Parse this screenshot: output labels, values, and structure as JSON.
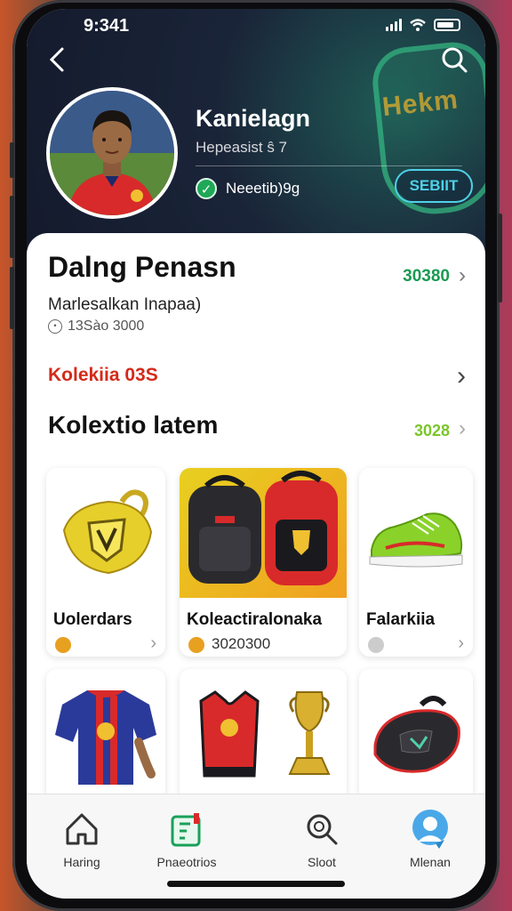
{
  "status_bar": {
    "time": "9:341"
  },
  "profile": {
    "name": "Kanielagn",
    "subtitle": "Hepeasist ŝ 7",
    "verified_label": "Neeetib)9g",
    "action_button": "SEBIIT",
    "banner_text": "Hekm"
  },
  "main": {
    "title": "Dalng Penasn",
    "title_count": "30380",
    "subtitle": "Marlesalkan Inapaa)",
    "meta": "13Sào 3000",
    "red_section": "Kolekiia 03S",
    "collection_title": "Kolextio latem",
    "collection_count": "3028"
  },
  "products": [
    {
      "name": "Uolerdars",
      "price": ""
    },
    {
      "name": "Koleactiralonaka",
      "price": "3020300"
    },
    {
      "name": "Falarkiia",
      "price": ""
    }
  ],
  "nav": {
    "items": [
      {
        "label": "Haring",
        "icon": "home-icon"
      },
      {
        "label": "Pnaeotrios",
        "icon": "document-icon"
      },
      {
        "label": "Sloot",
        "icon": "search-icon"
      },
      {
        "label": "Mlenan",
        "icon": "profile-icon"
      }
    ]
  },
  "colors": {
    "accent_green": "#1a9a52",
    "accent_red": "#d42a1a",
    "accent_cyan": "#4fd0e8"
  }
}
